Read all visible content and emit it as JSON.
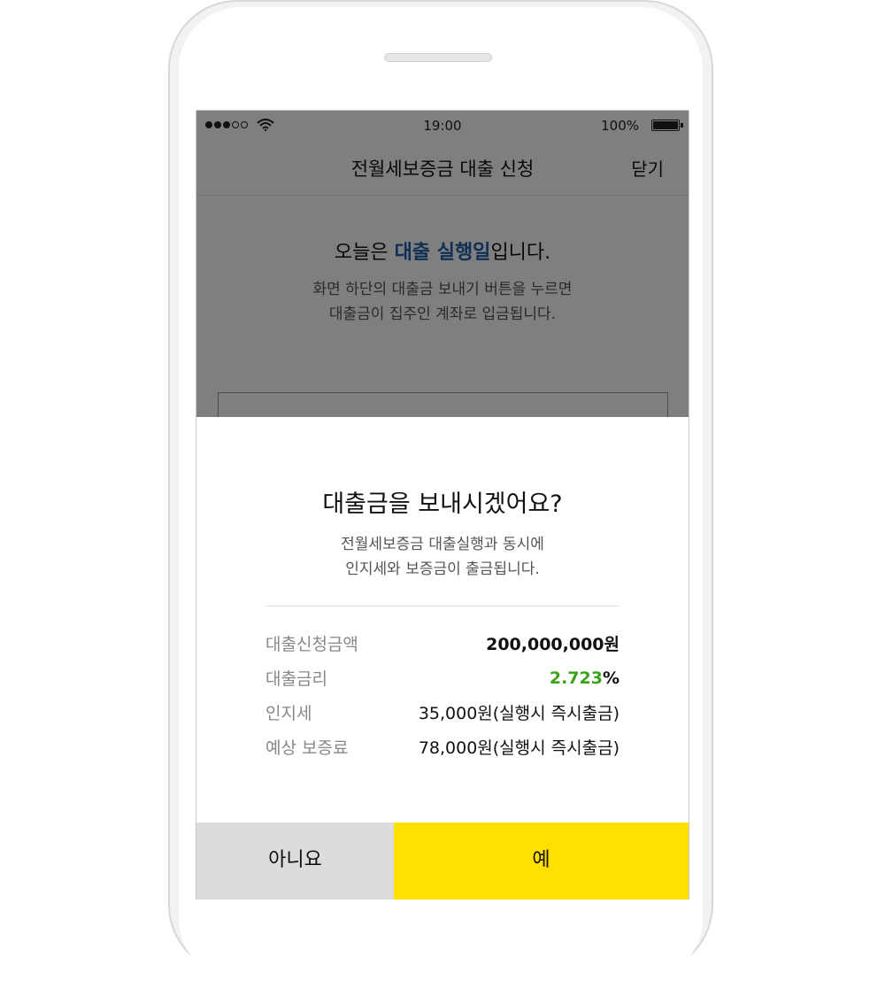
{
  "statusbar": {
    "time": "19:00",
    "battery": "100%"
  },
  "navbar": {
    "title": "전월세보증금 대출 신청",
    "close_label": "닫기"
  },
  "content": {
    "headline_prefix": "오늘은 ",
    "headline_highlight": "대출 실행일",
    "headline_suffix": "입니다.",
    "desc_line1": "화면 하단의 대출금 보내기 버튼을 누르면",
    "desc_line2": "대출금이 집주인 계좌로 입금됩니다."
  },
  "dialog": {
    "title": "대출금을 보내시겠어요?",
    "desc_line1": "전월세보증금 대출실행과 동시에",
    "desc_line2": "인지세와 보증금이 출금됩니다.",
    "rows": [
      {
        "label": "대출신청금액",
        "value": "200,000,000원"
      },
      {
        "label": "대출금리",
        "value_num": "2.723",
        "value_unit": "%"
      },
      {
        "label": "인지세",
        "value": "35,000원(실행시 즉시출금)"
      },
      {
        "label": "예상 보증료",
        "value": "78,000원(실행시 즉시출금)"
      }
    ],
    "no_label": "아니요",
    "yes_label": "예"
  },
  "colors": {
    "accent_yellow": "#ffe000",
    "rate_green": "#3aa31a",
    "highlight_blue": "#1f5fa8"
  }
}
